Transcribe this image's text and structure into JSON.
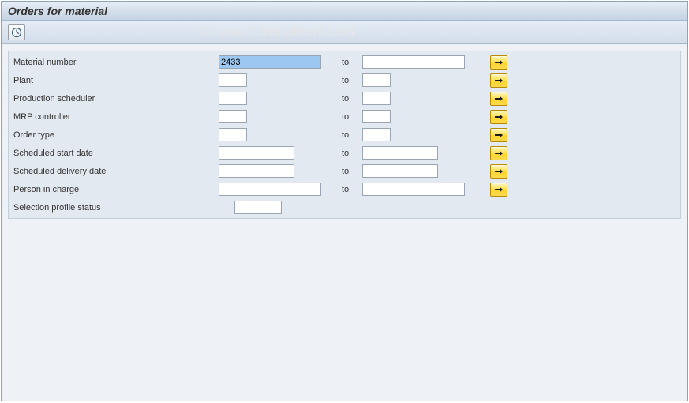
{
  "header": {
    "title": "Orders for material"
  },
  "watermark": "© www.tutorialkart.com",
  "labels": {
    "to": "to"
  },
  "fields": {
    "material_number": {
      "label": "Material number",
      "from": "2433",
      "to": ""
    },
    "plant": {
      "label": "Plant",
      "from": "",
      "to": ""
    },
    "production_scheduler": {
      "label": "Production scheduler",
      "from": "",
      "to": ""
    },
    "mrp_controller": {
      "label": "MRP controller",
      "from": "",
      "to": ""
    },
    "order_type": {
      "label": "Order type",
      "from": "",
      "to": ""
    },
    "scheduled_start_date": {
      "label": "Scheduled start date",
      "from": "",
      "to": ""
    },
    "scheduled_delivery_date": {
      "label": "Scheduled delivery date",
      "from": "",
      "to": ""
    },
    "person_in_charge": {
      "label": "Person in charge",
      "from": "",
      "to": ""
    },
    "selection_profile_status": {
      "label": "Selection profile status",
      "value": ""
    }
  }
}
